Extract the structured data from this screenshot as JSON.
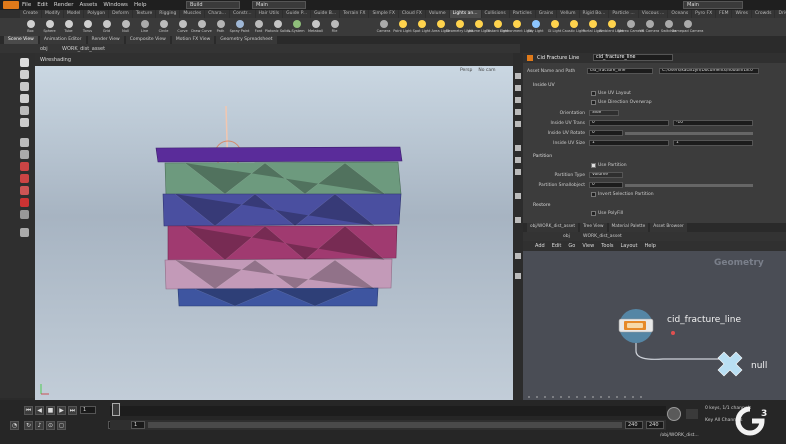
{
  "menubar": {
    "items": [
      "File",
      "Edit",
      "Render",
      "Assets",
      "Windows",
      "Help"
    ],
    "desktop": "Build",
    "desktop2": "Main",
    "desktop3": "Main"
  },
  "shelf_tabs": [
    "Create",
    "Modify",
    "Model",
    "Polygon",
    "Deform",
    "Texture",
    "Rigging",
    "Muscles",
    "Chara...",
    "Constr...",
    "Hair Utils",
    "Guide P...",
    "Guide B...",
    "Terrain FX",
    "Simple FX",
    "Cloud FX",
    "Volume",
    "Lights an...",
    "Collisions",
    "Particles",
    "Grains",
    "Vellum",
    "Rigid Bo...",
    "Particle ...",
    "Viscous ...",
    "Oceans",
    "Pyro FX",
    "FEM",
    "Wires",
    "Crowds",
    "Drive Sim..."
  ],
  "shelf_tools": [
    {
      "label": "Box",
      "color": "#d0d0d0"
    },
    {
      "label": "Sphere",
      "color": "#d0d0d0"
    },
    {
      "label": "Tube",
      "color": "#d0d0d0"
    },
    {
      "label": "Torus",
      "color": "#d0d0d0"
    },
    {
      "label": "Grid",
      "color": "#c8c8c8"
    },
    {
      "label": "Null",
      "color": "#bbbbbb"
    },
    {
      "label": "Line",
      "color": "#aaaaaa"
    },
    {
      "label": "Circle",
      "color": "#bbbbbb"
    },
    {
      "label": "Curve",
      "color": "#c0c0c0"
    },
    {
      "label": "Draw Curve",
      "color": "#bbbbbb"
    },
    {
      "label": "Path",
      "color": "#b5b5b5"
    },
    {
      "label": "Spray Paint",
      "color": "#9fb7d6"
    },
    {
      "label": "Font",
      "color": "#bbbbbb"
    },
    {
      "label": "Platonic Solids",
      "color": "#c5c5c5"
    },
    {
      "label": "L-System",
      "color": "#8fbf7a"
    },
    {
      "label": "Metaball",
      "color": "#c8c8c8"
    },
    {
      "label": "File",
      "color": "#bbbbbb"
    }
  ],
  "light_tools": [
    {
      "label": "Camera",
      "color": "#aaaaaa"
    },
    {
      "label": "Point Light",
      "color": "#ffd34d"
    },
    {
      "label": "Spot Light",
      "color": "#ffd34d"
    },
    {
      "label": "Area Light",
      "color": "#ffd34d"
    },
    {
      "label": "Geometry Light",
      "color": "#ffd34d"
    },
    {
      "label": "Volume Light",
      "color": "#ffd34d"
    },
    {
      "label": "Distant Light",
      "color": "#ffd34d"
    },
    {
      "label": "Environment Light",
      "color": "#ffd34d"
    },
    {
      "label": "Sky Light",
      "color": "#8cc6ff"
    },
    {
      "label": "GI Light",
      "color": "#ffd34d"
    },
    {
      "label": "Caustic Light",
      "color": "#ffd34d"
    },
    {
      "label": "Portal Light",
      "color": "#ffd34d"
    },
    {
      "label": "Ambient Light",
      "color": "#ffd34d"
    },
    {
      "label": "Stereo Camera",
      "color": "#aaaaaa"
    },
    {
      "label": "VR Camera",
      "color": "#aaaaaa"
    },
    {
      "label": "Switcher",
      "color": "#aaaaaa"
    },
    {
      "label": "Gamepad Camera",
      "color": "#aaaaaa"
    }
  ],
  "pane_tabs": [
    "Scene View",
    "Animation Editor",
    "Render View",
    "Composite View",
    "Motion FX View",
    "Geometry Spreadsheet"
  ],
  "path": {
    "obj": "obj",
    "asset": "WORK_dist_asset"
  },
  "viewport": {
    "label": "Wireshading",
    "persp": "Persp",
    "cam": "No cam"
  },
  "param_tabs": [
    "Cid Fracture Line",
    "cid_fracture_line"
  ],
  "params": {
    "asset_name_label": "Asset Name and Path",
    "asset_name_value": "cid_fracture_line",
    "asset_path_value": "C:/Users/katarzyn/Documents/houdini18.0",
    "section_uv": "Inside UV",
    "use_uv_layout": "Use UV Layout",
    "use_dir_overwrap": "Use Direction Overwrap",
    "orientation_label": "Orientation",
    "orientation_value": "Side",
    "uv_trans_label": "Inside UV Trans",
    "uv_trans_x": "0",
    "uv_trans_y": "-10",
    "uv_rotate_label": "Inside UV Rotate",
    "uv_rotate_value": "0",
    "uv_size_label": "Inside UV Size",
    "uv_size_x": "1",
    "uv_size_y": "1",
    "section_partition": "Partition",
    "use_partition": "Use Partition",
    "partition_type_label": "Partition Type",
    "partition_type_value": "Volume",
    "partition_small_label": "Partition Smallobject",
    "partition_small_value": "0",
    "invert_selection": "Invert Selection Partition",
    "section_restore": "Restore",
    "use_polyfill": "Use PolyFill"
  },
  "net_tabs": [
    "obj/WORK_dist_asset",
    "Tree View",
    "Material Palette",
    "Asset Browser"
  ],
  "net_path": {
    "obj": "obj",
    "asset": "WORK_dist_asset"
  },
  "net_menu": [
    "Add",
    "Edit",
    "Go",
    "View",
    "Tools",
    "Layout",
    "Help"
  ],
  "network": {
    "context": "Geometry",
    "node1": "cid_fracture_line",
    "node2": "null"
  },
  "timeline": {
    "frame": "1",
    "start": "1",
    "start2": "1",
    "end": "240",
    "end2": "240",
    "keys": "0 keys, 1/1 channels",
    "key_all": "Key All Channels",
    "path": "/obj/WORK_dist..."
  },
  "colors": {
    "accent": "#e07a1a",
    "network_bg": "#4a4d55",
    "viewport_top": "#cad7e2"
  }
}
